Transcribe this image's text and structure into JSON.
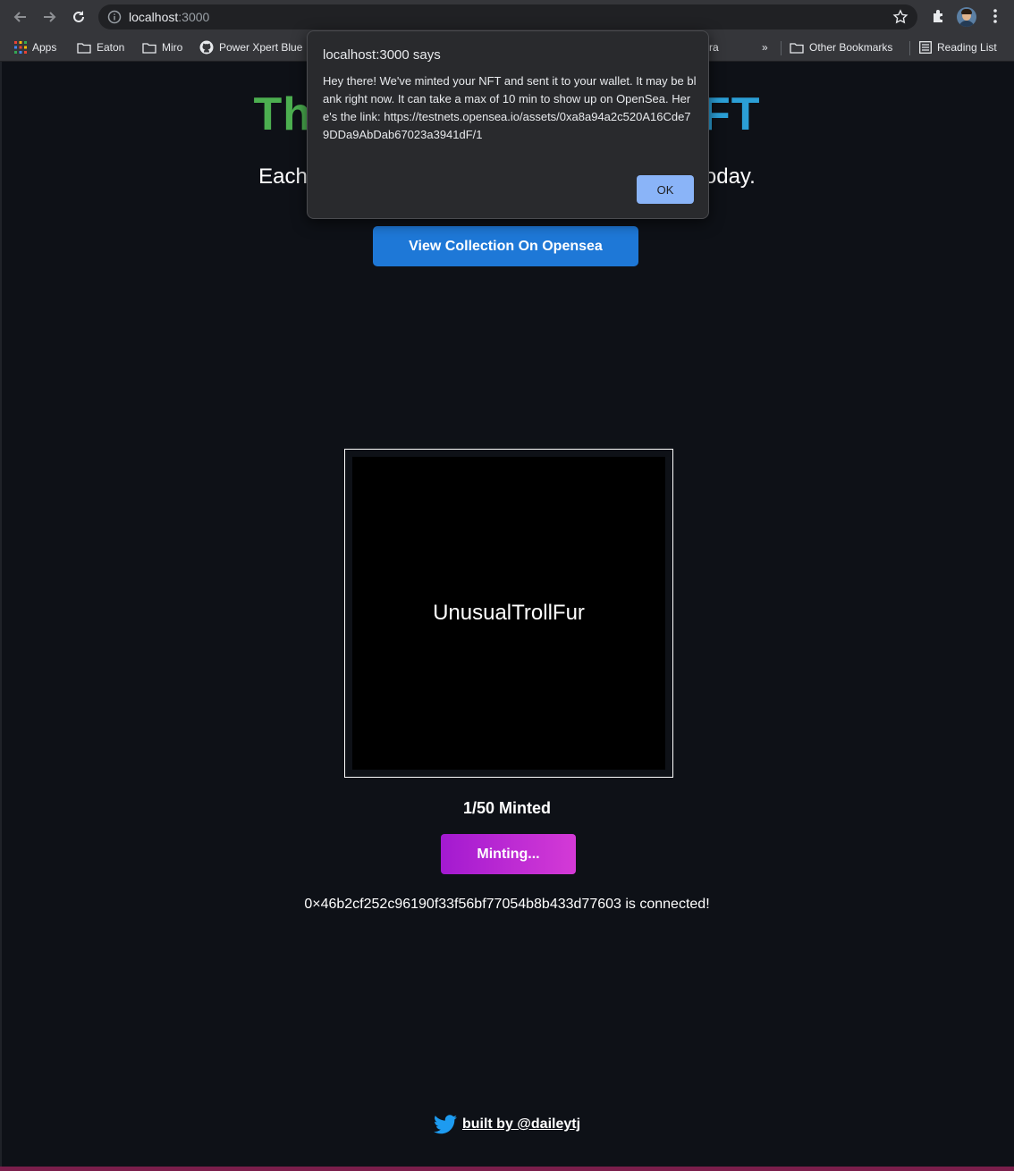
{
  "browser": {
    "url_host": "localhost",
    "url_port": ":3000",
    "bookmarks": {
      "apps": "Apps",
      "eaton": "Eaton",
      "miro": "Miro",
      "power_xpert": "Power Xpert Blue",
      "partial": "ra",
      "overflow": "»",
      "other": "Other Bookmarks",
      "reading_list": "Reading List"
    }
  },
  "hero": {
    "title_left": "Th",
    "title_right": "FT",
    "subtitle_left": "Each",
    "subtitle_right": "oday."
  },
  "cta": {
    "label": "View Collection On Opensea"
  },
  "nft": {
    "name": "UnusualTrollFur"
  },
  "mint": {
    "count_text": "1/50 Minted",
    "button_label": "Minting...",
    "connected_text": "0×46b2cf252c96190f33f56bf77054b8b433d77603 is connected!"
  },
  "footer": {
    "link_text": "built by @daileytj"
  },
  "dialog": {
    "title": "localhost:3000 says",
    "message": "Hey there! We've minted your NFT and sent it to your wallet. It may be blank right now. It can take a max of 10 min to show up on OpenSea. Here's the link: https://testnets.opensea.io/assets/0xa8a94a2c520A16Cde79DDa9AbDab67023a3941dF/1",
    "ok_label": "OK"
  },
  "colors": {
    "title_green": "#4caf50",
    "title_blue": "#2b9fd6",
    "cta_blue": "#1e78d7",
    "mint_gradient_start": "#a31ad0",
    "mint_gradient_end": "#d43ad6",
    "page_bg": "#0e1117"
  }
}
